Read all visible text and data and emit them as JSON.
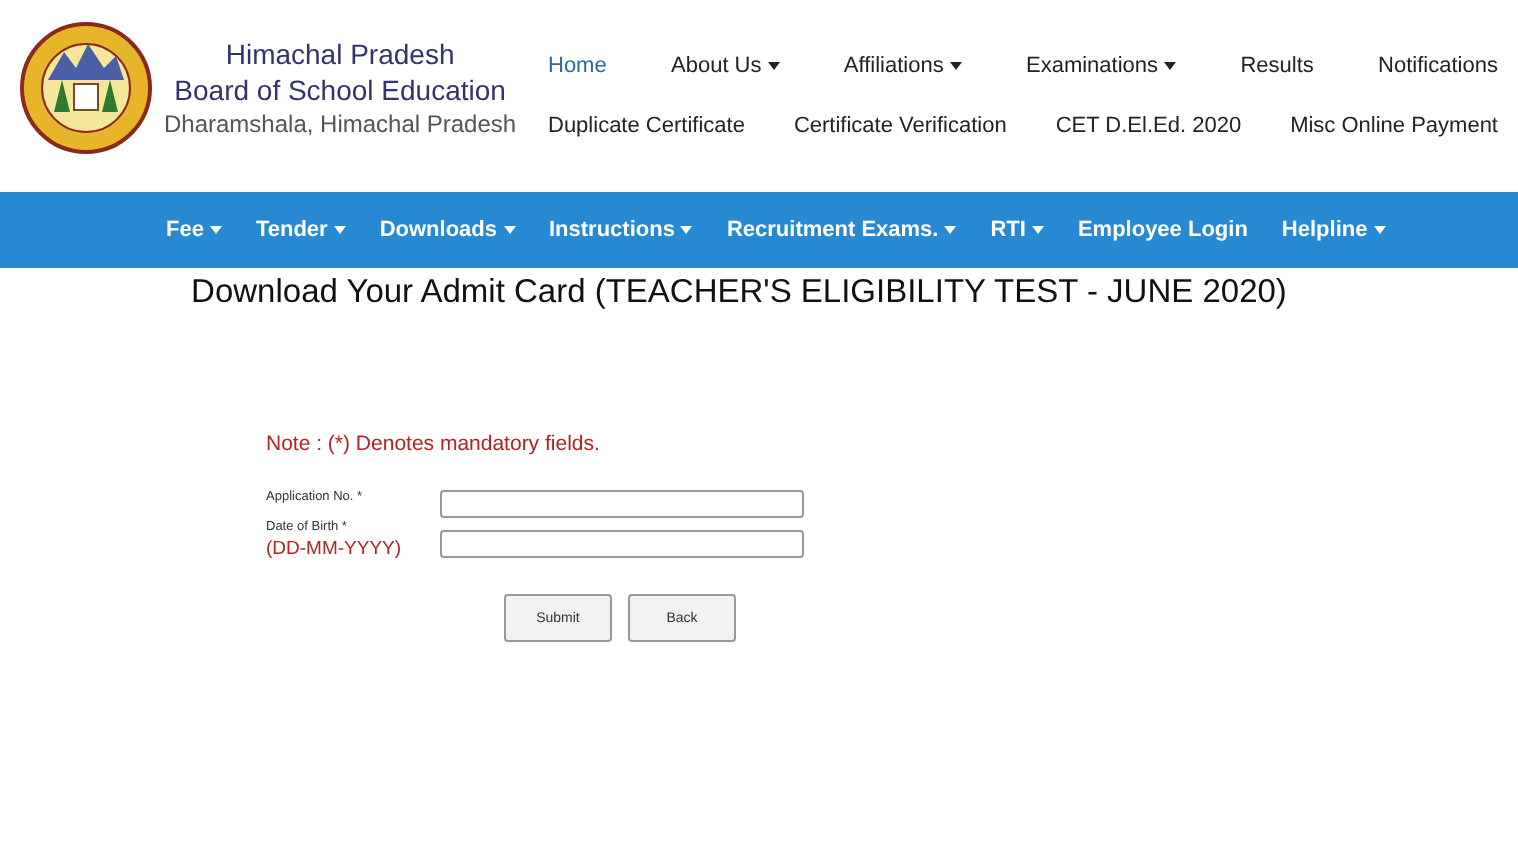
{
  "header": {
    "title_lines": [
      "Himachal Pradesh",
      "Board of School Education"
    ],
    "subtitle": "Dharamshala, Himachal Pradesh"
  },
  "top_nav": [
    [
      {
        "label": "Home",
        "selected": true,
        "dropdown": false
      },
      {
        "label": "About Us",
        "selected": false,
        "dropdown": true
      },
      {
        "label": "Affiliations",
        "selected": false,
        "dropdown": true
      },
      {
        "label": "Examinations",
        "selected": false,
        "dropdown": true
      },
      {
        "label": "Results",
        "selected": false,
        "dropdown": false
      },
      {
        "label": "Notifications",
        "selected": false,
        "dropdown": false
      }
    ],
    [
      {
        "label": "Duplicate Certificate",
        "selected": false,
        "dropdown": false
      },
      {
        "label": "Certificate Verification",
        "selected": false,
        "dropdown": false
      },
      {
        "label": "CET D.El.Ed. 2020",
        "selected": false,
        "dropdown": false
      },
      {
        "label": "Misc Online Payment",
        "selected": false,
        "dropdown": false
      }
    ]
  ],
  "main_nav": [
    {
      "label": "Fee",
      "dropdown": true
    },
    {
      "label": "Tender",
      "dropdown": true
    },
    {
      "label": "Downloads",
      "dropdown": true
    },
    {
      "label": "Instructions",
      "dropdown": true
    },
    {
      "label": "Recruitment Exams.",
      "dropdown": true
    },
    {
      "label": "RTI",
      "dropdown": true
    },
    {
      "label": "Employee Login",
      "dropdown": false
    },
    {
      "label": "Helpline",
      "dropdown": true
    }
  ],
  "page_title": "Download Your Admit Card (TEACHER'S ELIGIBILITY TEST - JUNE 2020)",
  "note": "Note  : (*) Denotes mandatory fields.",
  "fields": [
    {
      "label": "Application No. *"
    },
    {
      "label": "Date of Birth *",
      "hint": "(DD-MM-YYYY)"
    }
  ],
  "buttons": [
    "Submit",
    "Back"
  ]
}
